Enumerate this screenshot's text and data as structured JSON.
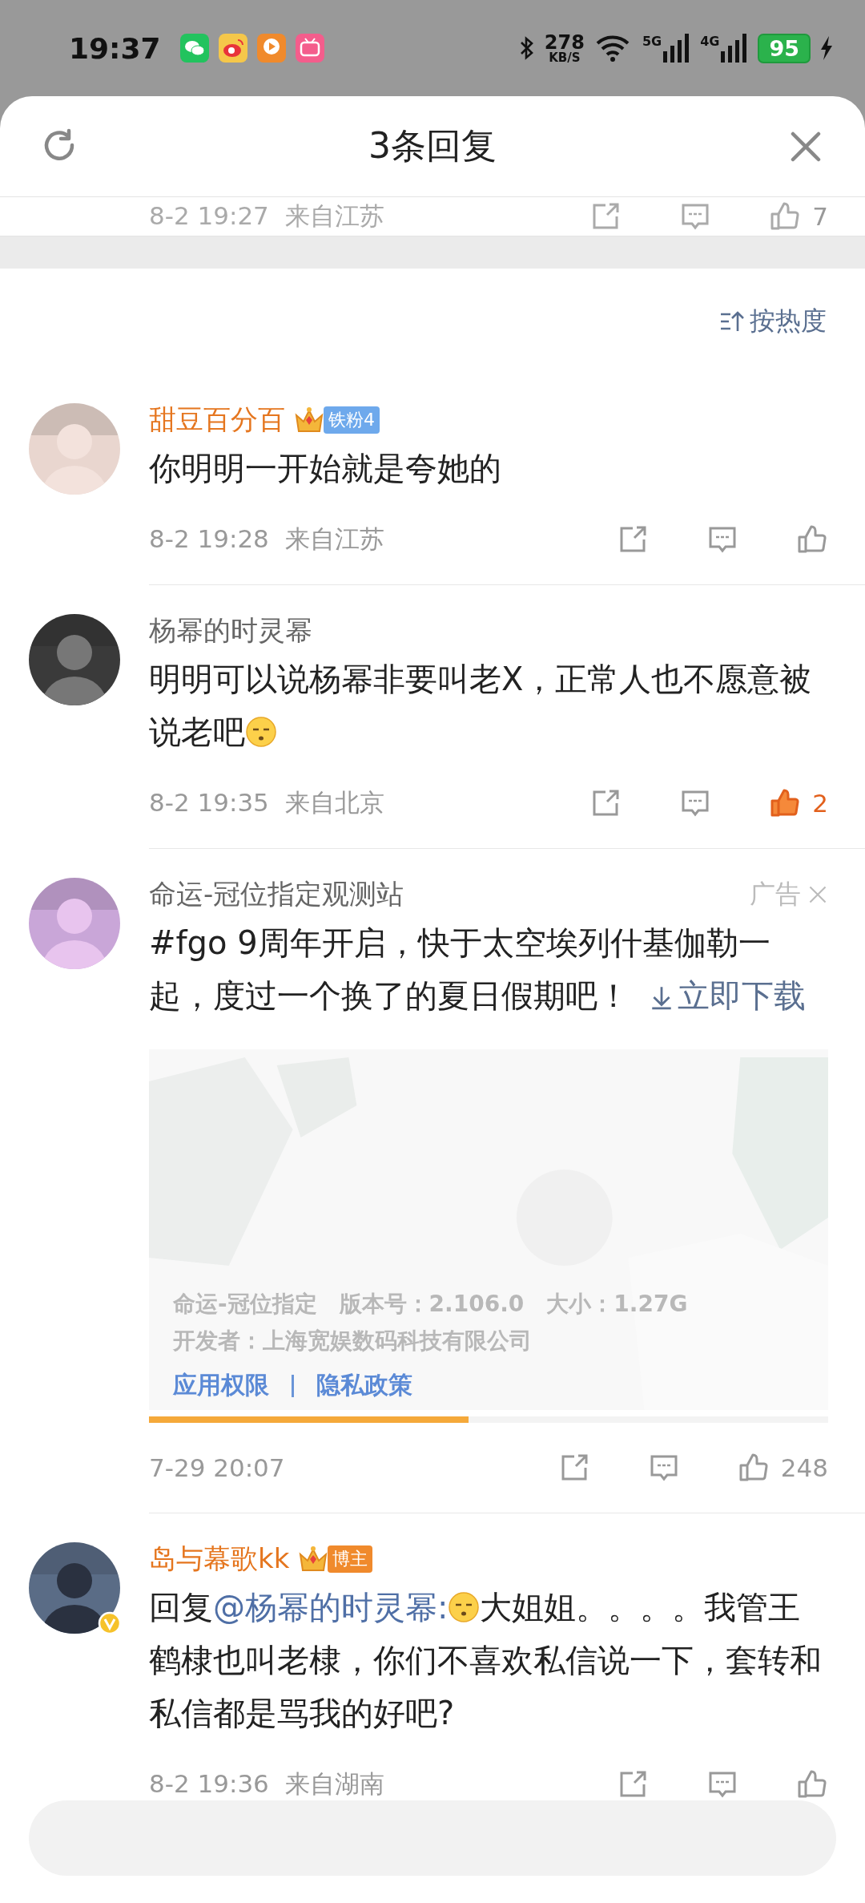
{
  "status_bar": {
    "time": "19:37",
    "speed": "278",
    "speed_unit": "KB/S",
    "networks": [
      "5G",
      "4G"
    ],
    "battery": "95",
    "charging": true
  },
  "header": {
    "title": "3条回复"
  },
  "previous_comment": {
    "time": "8-2 19:27",
    "location": "来自江苏",
    "likes": "7"
  },
  "sort": {
    "label": "按热度"
  },
  "comments": [
    {
      "kind": "comment",
      "author": "甜豆百分百",
      "author_highlight": true,
      "badge": {
        "kind": "fan",
        "label": "铁粉4"
      },
      "parts": [
        {
          "kind": "text",
          "text": "你明明一开始就是夸她的"
        }
      ],
      "time": "8-2 19:28",
      "location": "来自江苏",
      "liked": false
    },
    {
      "kind": "comment",
      "author": "杨幂的时灵幂",
      "author_highlight": false,
      "parts": [
        {
          "kind": "text",
          "text": "明明可以说杨幂非要叫老X，正常人也不愿意被说老吧"
        },
        {
          "kind": "emoji"
        }
      ],
      "time": "8-2 19:35",
      "location": "来自北京",
      "liked": true,
      "likes": "2"
    },
    {
      "kind": "ad",
      "author": "命运-冠位指定观测站",
      "author_highlight": false,
      "ad_label": "广告",
      "parts": [
        {
          "kind": "text",
          "text": "#fgo 9周年开启，快于太空埃列什基伽勒一起，度过一个换了的夏日假期吧！"
        },
        {
          "kind": "link",
          "text": "立即下载"
        }
      ],
      "card": {
        "info": "命运-冠位指定　版本号：2.106.0　大小：1.27G",
        "developer": "开发者：上海宽娱数码科技有限公司",
        "links": [
          "应用权限",
          "隐私政策"
        ],
        "level": 0.47
      },
      "time": "7-29 20:07",
      "liked": false,
      "likes": "248"
    },
    {
      "kind": "comment",
      "author": "岛与幕歌kk",
      "author_highlight": true,
      "verified": true,
      "badge": {
        "kind": "blogger",
        "label": "博主"
      },
      "parts": [
        {
          "kind": "text",
          "text": "回复"
        },
        {
          "kind": "mention",
          "text": "@杨幂的时灵幂:"
        },
        {
          "kind": "emoji"
        },
        {
          "kind": "text",
          "text": "大姐姐。。。。我管王鹤棣也叫老棣，你们不喜欢私信说一下，套转和私信都是骂我的好吧?"
        }
      ],
      "time": "8-2 19:36",
      "location": "来自湖南",
      "liked": false
    }
  ]
}
